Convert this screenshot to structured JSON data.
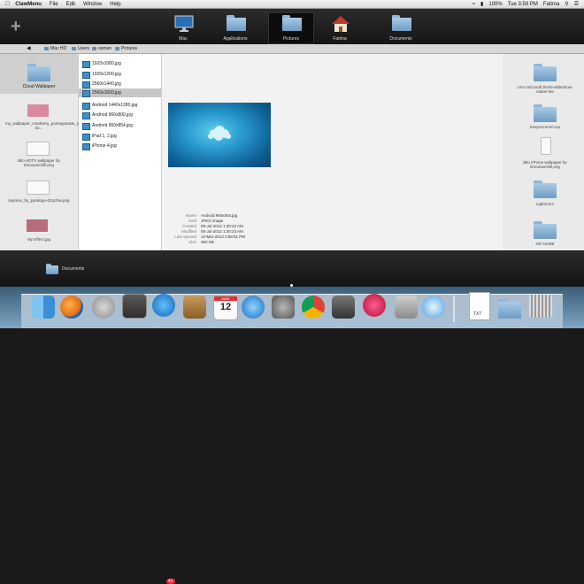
{
  "menubar": {
    "app_name": "ClawMenu",
    "items": [
      "File",
      "Edit",
      "Window",
      "Help"
    ],
    "battery": "100%",
    "clock": "Tue 3:59 PM",
    "user": "Fatima"
  },
  "quick_folders": [
    {
      "label": "Mac",
      "icon": "imac-icon"
    },
    {
      "label": "Applications",
      "icon": "folder-icon"
    },
    {
      "label": "Pictures",
      "icon": "folder-icon",
      "selected": true
    },
    {
      "label": "Fatima",
      "icon": "home-icon"
    },
    {
      "label": "Documents",
      "icon": "folder-icon"
    }
  ],
  "path": [
    "Mac HD",
    "Users",
    "osman",
    "Pictures"
  ],
  "left_items": [
    {
      "label": "Cloud Wallpaper"
    },
    {
      "label": "my_wallpaper_cranberry_pomegranate_juice_by_steam101-d1..."
    },
    {
      "label": "iBlo HDTV wallpaper by timooxarchill.png"
    },
    {
      "label": "kaymac_by_pyralogo-d1tyz5w.png"
    },
    {
      "label": "My Effect.jpg"
    }
  ],
  "files": [
    "1920x1080.jpg",
    "1920x1200.jpg",
    "2560x1440.jpg",
    "2560x1600.jpg",
    "Android 1440x1280.jpg",
    "Android 960x800.jpg",
    "Android 960x854.jpg",
    "iPad 1, 2.jpg",
    "iPhone 4.jpg"
  ],
  "selected_file": "2560x1600.jpg",
  "info": {
    "name_label": "Name",
    "name": "Android 960x854.jpg",
    "kind_label": "Kind",
    "kind": "JPEG image",
    "created_label": "Created",
    "created": "05-Jul-2012 1:30:23 AM",
    "modified_label": "Modified",
    "modified": "05-Jul-2012 1:30:23 AM",
    "opened_label": "Last opened",
    "opened": "12-Mar-2013 3:58:51 PM",
    "size_label": "Size",
    "size": "360 KB"
  },
  "right_items": [
    {
      "label": "com.microsoft.html5-slideshow-maker-lite"
    },
    {
      "label": "EasyScreenCrop"
    },
    {
      "label": "iBlo iPhone wallpaper by timooxarchill.png"
    },
    {
      "label": "Lightroom"
    },
    {
      "label": "NO NAME"
    }
  ],
  "shelf": {
    "label": "Documents"
  },
  "dock": {
    "badge": "41",
    "calendar_month": "MAR",
    "calendar_day": "12",
    "txt_label": "TXT"
  }
}
